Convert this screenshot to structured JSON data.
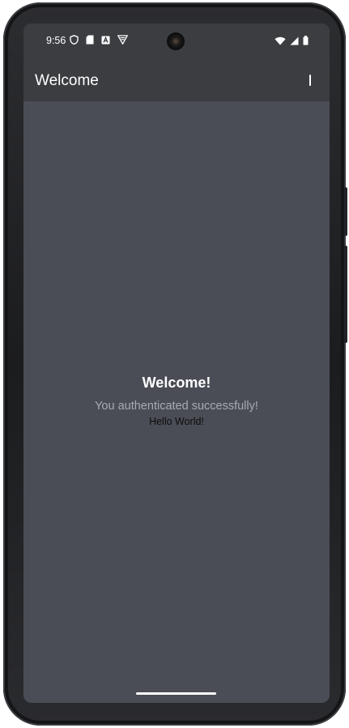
{
  "status_bar": {
    "time": "9:56",
    "left_icons": [
      "shield-icon",
      "sd-card-icon",
      "a-badge-icon",
      "vpn-icon"
    ],
    "right_icons": [
      "wifi-icon",
      "signal-icon",
      "battery-icon"
    ]
  },
  "app_bar": {
    "title": "Welcome",
    "overflow_icon": "more-vert-icon"
  },
  "main": {
    "heading": "Welcome!",
    "subtitle": "You authenticated successfully!",
    "message": "Hello World!"
  },
  "colors": {
    "app_bar_bg": "#3b3d41",
    "content_bg": "#4a4d55",
    "subtitle_text": "#a9abb1",
    "message_text": "#0c0c0c"
  }
}
